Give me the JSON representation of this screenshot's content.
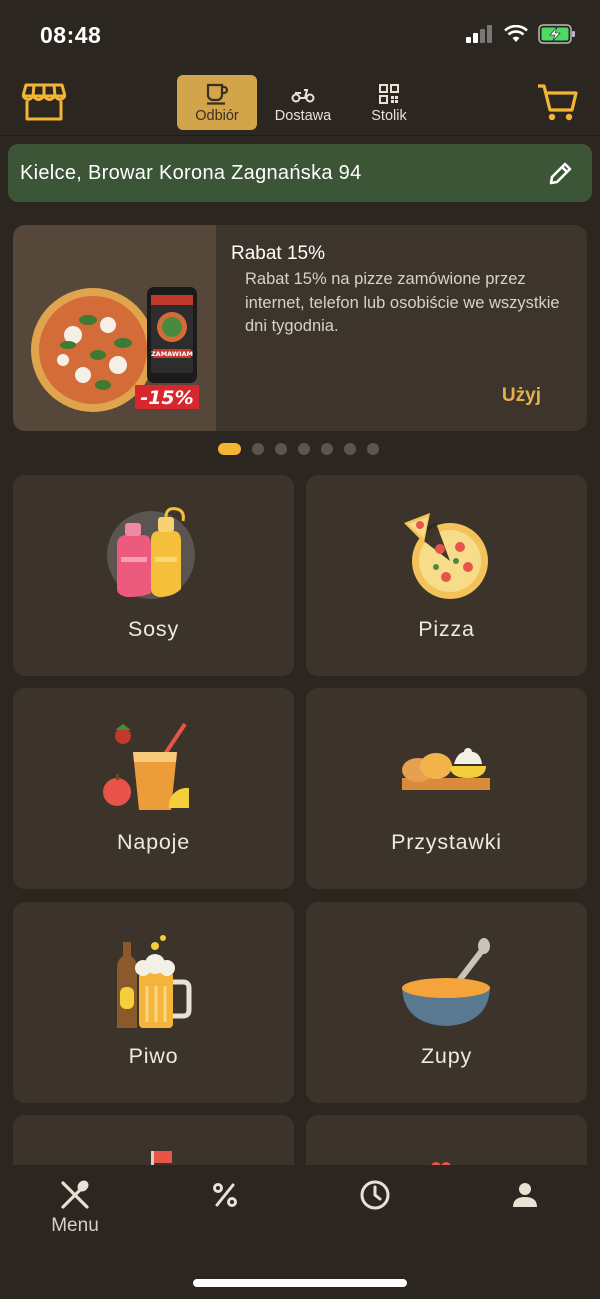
{
  "status_bar": {
    "time": "08:48"
  },
  "order_modes": [
    {
      "label": "Odbiór",
      "icon": "cup-icon",
      "active": true
    },
    {
      "label": "Dostawa",
      "icon": "scooter-icon",
      "active": false
    },
    {
      "label": "Stolik",
      "icon": "qr-code-icon",
      "active": false
    }
  ],
  "address": {
    "text": "Kielce, Browar Korona Zagnańska 94"
  },
  "promo": {
    "title": "Rabat 15%",
    "description": "Rabat 15% na pizze zamówione przez internet, telefon lub osobiście we wszystkie dni tygodnia.",
    "action_label": "Użyj",
    "image_badge": "-15%",
    "image_button": "ZAMAWIAM",
    "active_slide": 1,
    "slide_count": 7
  },
  "categories": [
    {
      "label": "Sosy",
      "icon": "sauce-bottles-icon"
    },
    {
      "label": "Pizza",
      "icon": "pizza-icon"
    },
    {
      "label": "Napoje",
      "icon": "drink-icon"
    },
    {
      "label": "Przystawki",
      "icon": "appetizers-icon"
    },
    {
      "label": "Piwo",
      "icon": "beer-icon"
    },
    {
      "label": "Zupy",
      "icon": "soup-bowl-icon"
    }
  ],
  "bottom_nav": [
    {
      "label": "Menu",
      "icon": "utensils-icon",
      "active": true
    },
    {
      "label": "",
      "icon": "percent-icon",
      "active": false
    },
    {
      "label": "",
      "icon": "clock-icon",
      "active": false
    },
    {
      "label": "",
      "icon": "user-icon",
      "active": false
    }
  ],
  "colors": {
    "background": "#2b2620",
    "card": "#3c342a",
    "accent": "#d3a54a",
    "address_bar": "#3b5536",
    "use_link": "#e6b049"
  }
}
